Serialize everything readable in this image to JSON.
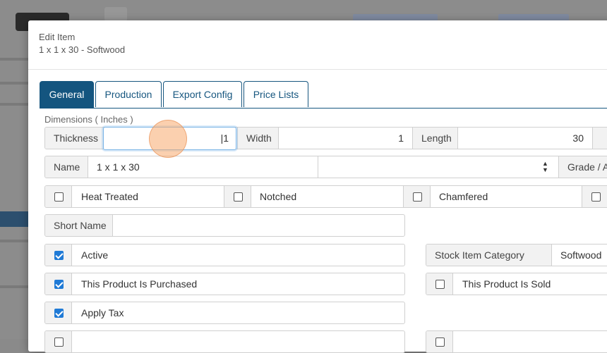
{
  "modal": {
    "header_title": "Edit Item",
    "header_subtitle": "1 x 1 x 30 - Softwood"
  },
  "tabs": [
    {
      "label": "General",
      "active": true
    },
    {
      "label": "Production",
      "active": false
    },
    {
      "label": "Export Config",
      "active": false
    },
    {
      "label": "Price Lists",
      "active": false
    }
  ],
  "dimensions": {
    "section_label": "Dimensions ( Inches )",
    "thickness_label": "Thickness",
    "thickness_value": "1",
    "width_label": "Width",
    "width_value": "1",
    "length_label": "Length",
    "length_value": "30"
  },
  "name_row": {
    "name_label": "Name",
    "name_value": "1 x 1 x 30",
    "grade_label": "Grade / A"
  },
  "treatments": [
    {
      "label": "Heat Treated",
      "checked": false
    },
    {
      "label": "Notched",
      "checked": false
    },
    {
      "label": "Chamfered",
      "checked": false
    }
  ],
  "short_name": {
    "label": "Short Name",
    "value": ""
  },
  "flags": {
    "active": {
      "label": "Active",
      "checked": true
    },
    "purchased": {
      "label": "This Product Is Purchased",
      "checked": true
    },
    "sold": {
      "label": "This Product Is Sold",
      "checked": false
    },
    "apply_tax": {
      "label": "Apply Tax",
      "checked": true
    }
  },
  "stock_category": {
    "label": "Stock Item Category",
    "value": "Softwood"
  },
  "colors": {
    "primary": "#14557f",
    "checkbox": "#1f7ad6",
    "focus": "#7ab4e6"
  }
}
